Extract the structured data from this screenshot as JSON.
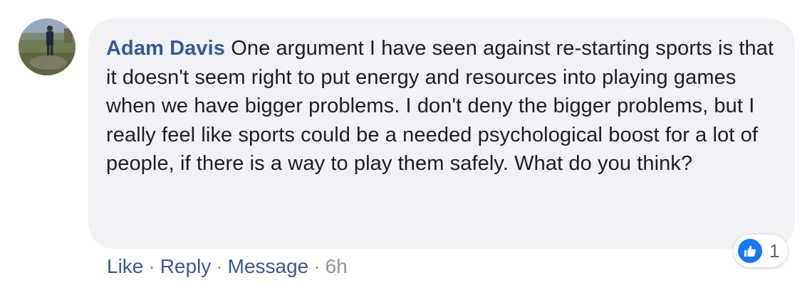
{
  "comment": {
    "author": "Adam Davis",
    "text": "One argument I have seen against re-starting sports is that it doesn't seem right to put energy and resources into playing games when we have bigger problems. I don't deny the bigger problems, but I really feel like sports could be a needed psychological boost for a lot of people, if there is a way to play them safely. What do you think?"
  },
  "reactions": {
    "icon": "thumbs-up-icon",
    "count": "1",
    "color": "#1877f2"
  },
  "actions": {
    "like_label": "Like",
    "reply_label": "Reply",
    "message_label": "Message",
    "separator": "·",
    "timestamp": "6h"
  },
  "colors": {
    "link": "#385898",
    "bubble": "#f0f2f5",
    "text": "#1c1e21",
    "muted": "#90949c"
  }
}
